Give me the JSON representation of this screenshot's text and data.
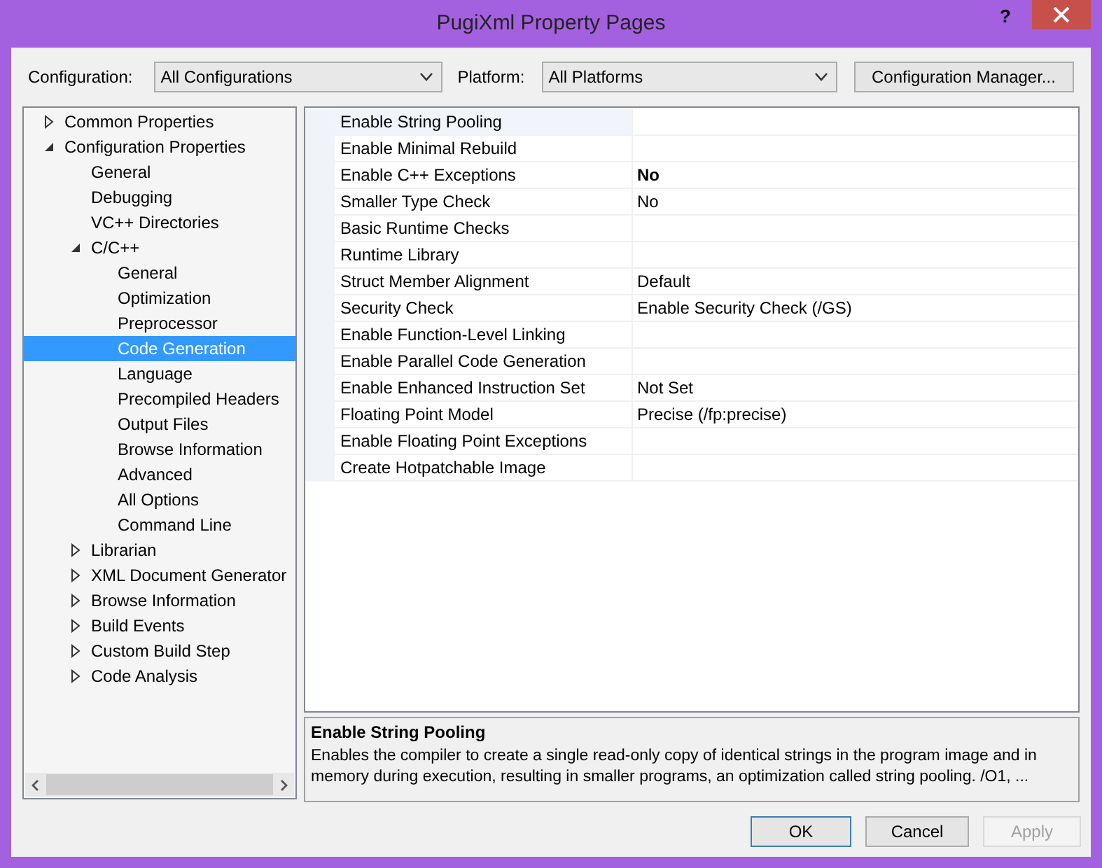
{
  "window": {
    "title": "PugiXml Property Pages",
    "help": "?"
  },
  "toolbar": {
    "configuration_label": "Configuration:",
    "configuration": "All Configurations",
    "platform_label": "Platform:",
    "platform": "All Platforms",
    "manager_button": "Configuration Manager..."
  },
  "tree": [
    {
      "label": "Common Properties",
      "expanded": false,
      "selected": false
    },
    {
      "label": "Configuration Properties",
      "expanded": true,
      "selected": false,
      "children": [
        {
          "label": "General",
          "selected": false
        },
        {
          "label": "Debugging",
          "selected": false
        },
        {
          "label": "VC++ Directories",
          "selected": false
        },
        {
          "label": "C/C++",
          "expanded": true,
          "selected": false,
          "children": [
            {
              "label": "General",
              "selected": false
            },
            {
              "label": "Optimization",
              "selected": false
            },
            {
              "label": "Preprocessor",
              "selected": false
            },
            {
              "label": "Code Generation",
              "selected": true
            },
            {
              "label": "Language",
              "selected": false
            },
            {
              "label": "Precompiled Headers",
              "selected": false
            },
            {
              "label": "Output Files",
              "selected": false
            },
            {
              "label": "Browse Information",
              "selected": false
            },
            {
              "label": "Advanced",
              "selected": false
            },
            {
              "label": "All Options",
              "selected": false
            },
            {
              "label": "Command Line",
              "selected": false
            }
          ]
        },
        {
          "label": "Librarian",
          "expanded": false,
          "selected": false
        },
        {
          "label": "XML Document Generator",
          "expanded": false,
          "selected": false
        },
        {
          "label": "Browse Information",
          "expanded": false,
          "selected": false
        },
        {
          "label": "Build Events",
          "expanded": false,
          "selected": false
        },
        {
          "label": "Custom Build Step",
          "expanded": false,
          "selected": false
        },
        {
          "label": "Code Analysis",
          "expanded": false,
          "selected": false
        }
      ]
    }
  ],
  "properties": [
    {
      "name": "Enable String Pooling",
      "selected": true
    },
    {
      "name": "Enable Minimal Rebuild",
      "selected": false
    },
    {
      "name": "Enable C++ Exceptions",
      "value": "No",
      "selected": false,
      "modified": true
    },
    {
      "name": "Smaller Type Check",
      "value": "No",
      "selected": false,
      "modified": false
    },
    {
      "name": "Basic Runtime Checks",
      "selected": false
    },
    {
      "name": "Runtime Library",
      "selected": false
    },
    {
      "name": "Struct Member Alignment",
      "value": "Default",
      "selected": false,
      "modified": false
    },
    {
      "name": "Security Check",
      "value": "Enable Security Check (/GS)",
      "selected": false,
      "modified": false
    },
    {
      "name": "Enable Function-Level Linking",
      "selected": false
    },
    {
      "name": "Enable Parallel Code Generation",
      "selected": false
    },
    {
      "name": "Enable Enhanced Instruction Set",
      "value": "Not Set",
      "selected": false,
      "modified": false
    },
    {
      "name": "Floating Point Model",
      "value": "Precise (/fp:precise)",
      "selected": false,
      "modified": false
    },
    {
      "name": "Enable Floating Point Exceptions",
      "selected": false
    },
    {
      "name": "Create Hotpatchable Image",
      "selected": false
    }
  ],
  "description": {
    "title": "Enable String Pooling",
    "text": "Enables the compiler to create a single read-only copy of identical strings in the program image and in memory during execution, resulting in smaller programs, an optimization called string pooling. /O1, ..."
  },
  "buttons": [
    {
      "label": "OK",
      "default": true,
      "disabled": false
    },
    {
      "label": "Cancel",
      "default": false,
      "disabled": false
    },
    {
      "label": "Apply",
      "default": false,
      "disabled": true
    }
  ]
}
